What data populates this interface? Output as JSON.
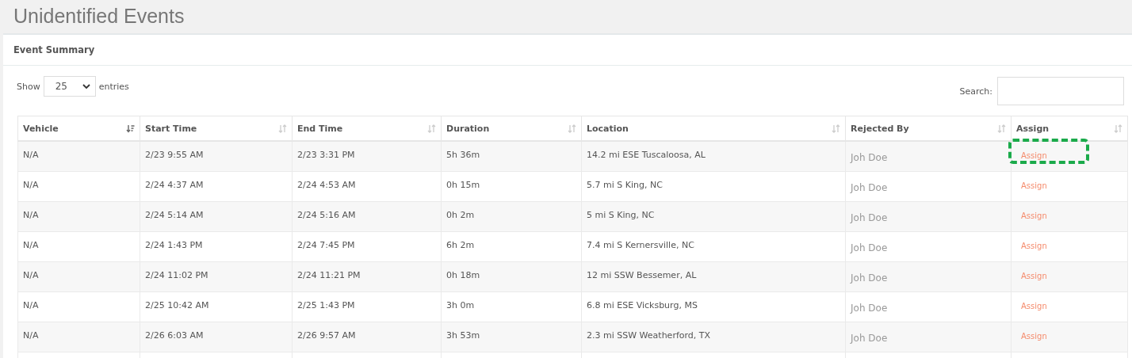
{
  "page": {
    "title": "Unidentified Events"
  },
  "panel": {
    "title": "Event Summary"
  },
  "length_menu": {
    "before": "Show",
    "value": "25",
    "after": "entries"
  },
  "search": {
    "label": "Search:"
  },
  "table": {
    "columns": [
      {
        "label": "Vehicle",
        "sorted": true
      },
      {
        "label": "Start Time",
        "sorted": false
      },
      {
        "label": "End Time",
        "sorted": false
      },
      {
        "label": "Duration",
        "sorted": false
      },
      {
        "label": "Location",
        "sorted": false
      },
      {
        "label": "Rejected By",
        "sorted": false
      },
      {
        "label": "Assign",
        "sorted": false
      }
    ],
    "rows": [
      {
        "vehicle": "N/A",
        "start": "2/23 9:55 AM",
        "end": "2/23 3:31 PM",
        "duration": "5h 36m",
        "location": "14.2 mi ESE Tuscaloosa, AL",
        "rejected_by": "Joh Doe",
        "assign": "Assign",
        "highlighted": true
      },
      {
        "vehicle": "N/A",
        "start": "2/24 4:37 AM",
        "end": "2/24 4:53 AM",
        "duration": "0h 15m",
        "location": "5.7 mi S King, NC",
        "rejected_by": "Joh Doe",
        "assign": "Assign",
        "highlighted": false
      },
      {
        "vehicle": "N/A",
        "start": "2/24 5:14 AM",
        "end": "2/24 5:16 AM",
        "duration": "0h 2m",
        "location": "5 mi S King, NC",
        "rejected_by": "Joh Doe",
        "assign": "Assign",
        "highlighted": false
      },
      {
        "vehicle": "N/A",
        "start": "2/24 1:43 PM",
        "end": "2/24 7:45 PM",
        "duration": "6h 2m",
        "location": "7.4 mi S Kernersville, NC",
        "rejected_by": "Joh Doe",
        "assign": "Assign",
        "highlighted": false
      },
      {
        "vehicle": "N/A",
        "start": "2/24 11:02 PM",
        "end": "2/24 11:21 PM",
        "duration": "0h 18m",
        "location": "12 mi SSW Bessemer, AL",
        "rejected_by": "Joh Doe",
        "assign": "Assign",
        "highlighted": false
      },
      {
        "vehicle": "N/A",
        "start": "2/25 10:42 AM",
        "end": "2/25 1:43 PM",
        "duration": "3h 0m",
        "location": "6.8 mi ESE Vicksburg, MS",
        "rejected_by": "Joh Doe",
        "assign": "Assign",
        "highlighted": false
      },
      {
        "vehicle": "N/A",
        "start": "2/26 6:03 AM",
        "end": "2/26 9:57 AM",
        "duration": "3h 53m",
        "location": "2.3 mi SSW Weatherford, TX",
        "rejected_by": "Joh Doe",
        "assign": "Assign",
        "highlighted": false
      }
    ]
  }
}
